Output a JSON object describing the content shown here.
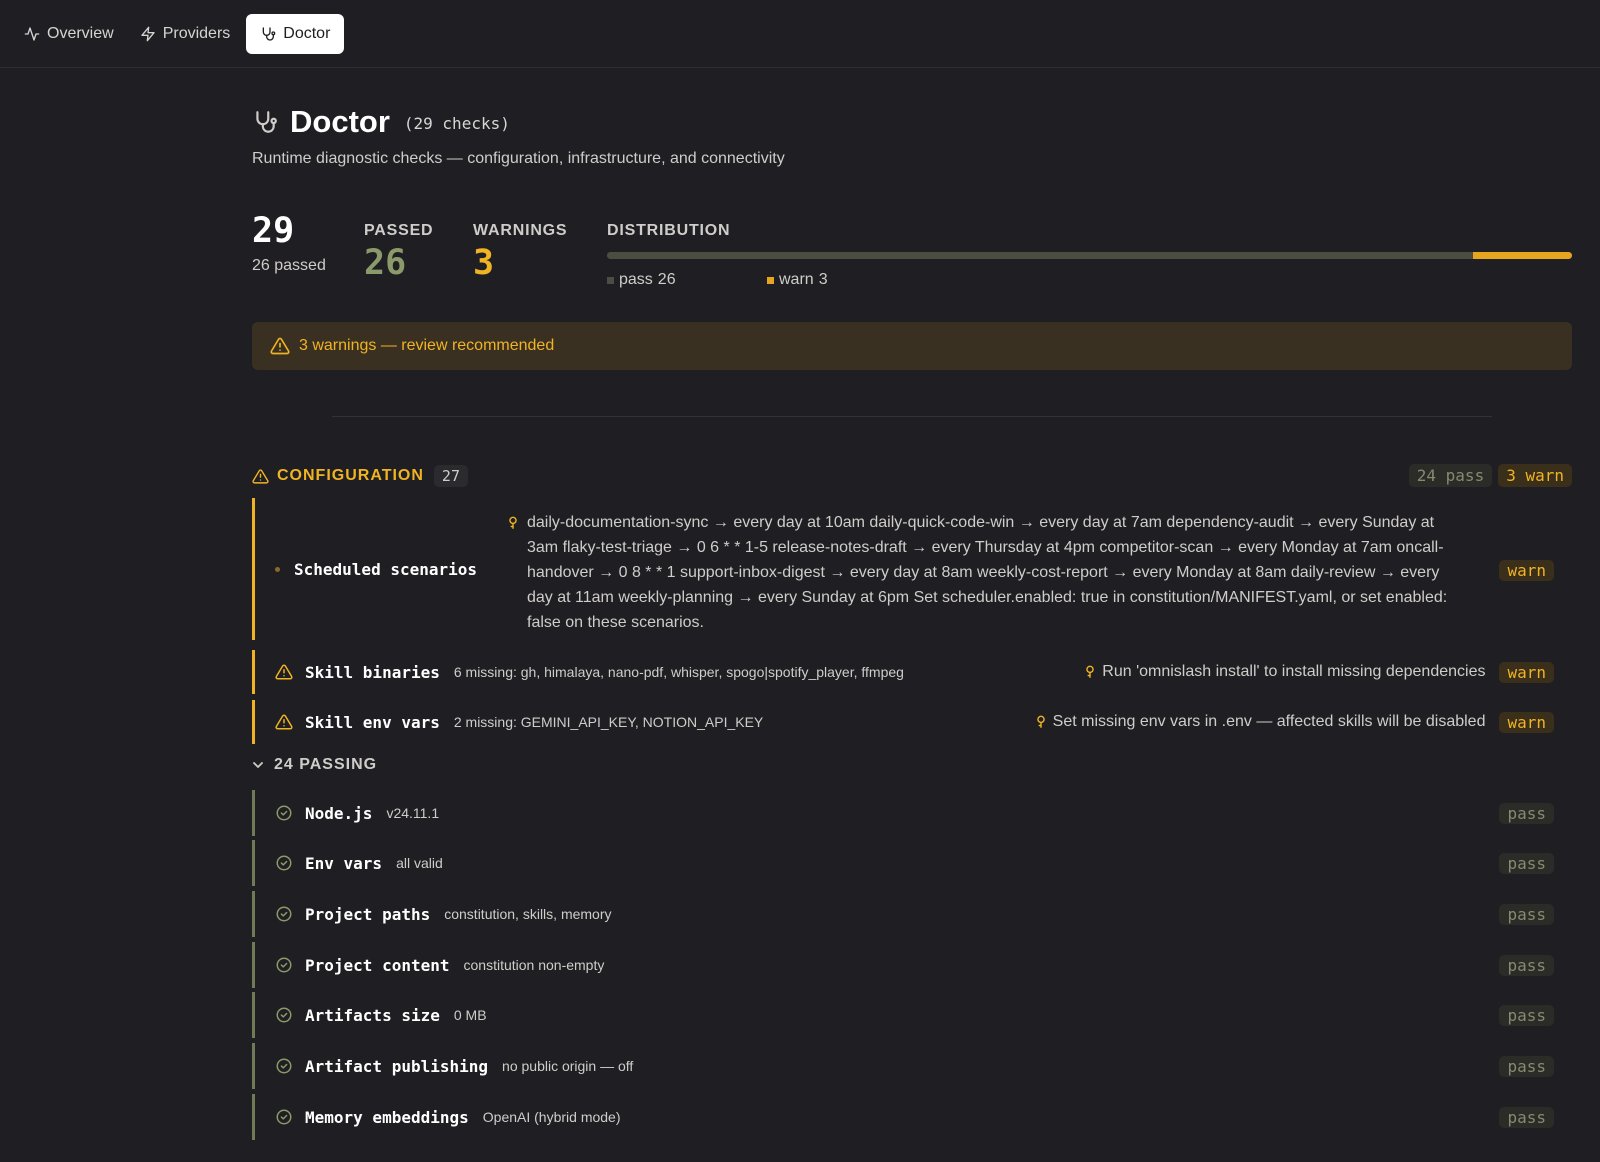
{
  "nav": {
    "tabs": [
      {
        "label": "Overview",
        "icon": "activity-icon"
      },
      {
        "label": "Providers",
        "icon": "zap-icon"
      },
      {
        "label": "Doctor",
        "icon": "stethoscope-icon",
        "active": true
      }
    ]
  },
  "header": {
    "title": "Doctor",
    "count": "(29 checks)",
    "subtitle": "Runtime diagnostic checks — configuration, infrastructure, and connectivity"
  },
  "stats": {
    "total": "29",
    "total_sub": "26 passed",
    "passed_label": "PASSED",
    "passed_value": "26",
    "warnings_label": "WARNINGS",
    "warnings_value": "3",
    "distribution_label": "DISTRIBUTION",
    "dist_pass_label": "pass",
    "dist_pass_value": "26",
    "dist_warn_label": "warn",
    "dist_warn_value": "3",
    "pass_fraction": 0.897,
    "warn_fraction": 0.103
  },
  "banner": {
    "text": "3 warnings — review recommended"
  },
  "section": {
    "title": "CONFIGURATION",
    "count": "27",
    "pass_pill": "24 pass",
    "warn_pill": "3 warn"
  },
  "warnings": [
    {
      "name": "Scheduled scenarios",
      "detail": "",
      "hint": "daily-documentation-sync → every day at 10am daily-quick-code-win → every day at 7am dependency-audit → every Sunday at 3am flaky-test-triage → 0 6 * * 1-5 release-notes-draft → every Thursday at 4pm competitor-scan → every Monday at 7am oncall-handover → 0 8 * * 1 support-inbox-digest → every day at 8am weekly-cost-report → every Monday at 8am daily-review → every day at 11am weekly-planning → every Sunday at 6pm Set scheduler.enabled: true in constitution/MANIFEST.yaml, or set enabled: false on these scenarios.",
      "status": "warn"
    },
    {
      "name": "Skill binaries",
      "detail": "6 missing: gh, himalaya, nano-pdf, whisper, spogo|spotify_player, ffmpeg",
      "hint": "Run 'omnislash install' to install missing dependencies",
      "status": "warn"
    },
    {
      "name": "Skill env vars",
      "detail": "2 missing: GEMINI_API_KEY, NOTION_API_KEY",
      "hint": "Set missing env vars in .env — affected skills will be disabled",
      "status": "warn"
    }
  ],
  "passing": {
    "label": "24 PASSING",
    "items": [
      {
        "name": "Node.js",
        "detail": "v24.11.1",
        "status": "pass"
      },
      {
        "name": "Env vars",
        "detail": "all valid",
        "status": "pass"
      },
      {
        "name": "Project paths",
        "detail": "constitution, skills, memory",
        "status": "pass"
      },
      {
        "name": "Project content",
        "detail": "constitution non-empty",
        "status": "pass"
      },
      {
        "name": "Artifacts size",
        "detail": "0 MB",
        "status": "pass"
      },
      {
        "name": "Artifact publishing",
        "detail": "no public origin — off",
        "status": "pass"
      },
      {
        "name": "Memory embeddings",
        "detail": "OpenAI (hybrid mode)",
        "status": "pass"
      }
    ]
  },
  "colors": {
    "background": "#1f1e22",
    "warn": "#f0b323",
    "pass": "#8b9a6a"
  }
}
